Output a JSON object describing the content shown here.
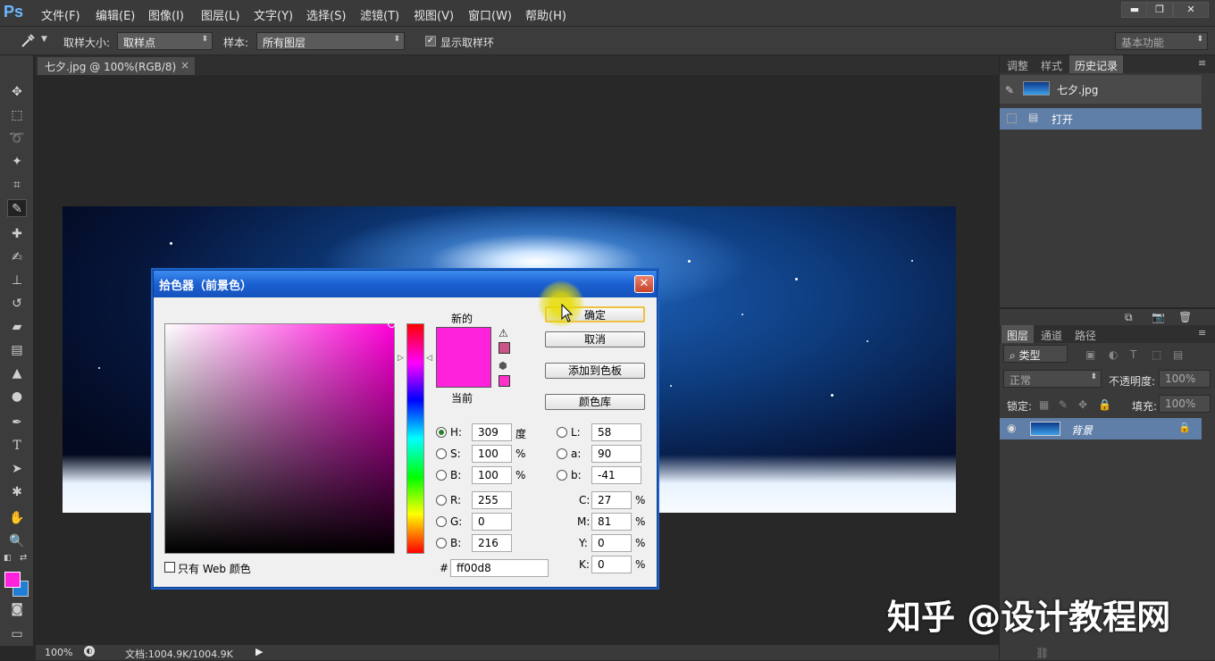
{
  "app": {
    "logo": "Ps"
  },
  "menu": [
    "文件(F)",
    "编辑(E)",
    "图像(I)",
    "图层(L)",
    "文字(Y)",
    "选择(S)",
    "滤镜(T)",
    "视图(V)",
    "窗口(W)",
    "帮助(H)"
  ],
  "window_controls": {
    "minimize": "▬",
    "restore": "❐",
    "close": "✕"
  },
  "options": {
    "sample_size_label": "取样大小:",
    "sample_size_value": "取样点",
    "sample_label": "样本:",
    "sample_value": "所有图层",
    "show_ring_label": "显示取样环",
    "show_ring_checked": true,
    "workspace": "基本功能"
  },
  "document": {
    "tab_title": "七夕.jpg @ 100%(RGB/8)",
    "close": "×"
  },
  "status": {
    "zoom": "100%",
    "doc_info": "文档:1004.9K/1004.9K"
  },
  "history_panel": {
    "tabs": [
      "调整",
      "样式",
      "历史记录"
    ],
    "snapshot": "七夕.jpg",
    "items": [
      "打开"
    ]
  },
  "layers_panel": {
    "tabs": [
      "图层",
      "通道",
      "路径"
    ],
    "filter": "类型",
    "blend_mode": "正常",
    "opacity_label": "不透明度:",
    "opacity": "100%",
    "lock_label": "锁定:",
    "fill_label": "填充:",
    "fill": "100%",
    "layers": [
      {
        "name": "背景",
        "visible": true,
        "locked": true
      }
    ]
  },
  "color_picker": {
    "title": "拾色器（前景色）",
    "close": "✕",
    "new_label": "新的",
    "current_label": "当前",
    "new_color": "#ff22dd",
    "current_color": "#ff22dd",
    "buttons": {
      "ok": "确定",
      "cancel": "取消",
      "add_swatch": "添加到色板",
      "color_libraries": "颜色库"
    },
    "hsb": [
      {
        "label": "H:",
        "value": "309",
        "unit": "度"
      },
      {
        "label": "S:",
        "value": "100",
        "unit": "%"
      },
      {
        "label": "B:",
        "value": "100",
        "unit": "%"
      }
    ],
    "rgb": [
      {
        "label": "R:",
        "value": "255"
      },
      {
        "label": "G:",
        "value": "0"
      },
      {
        "label": "B:",
        "value": "216"
      }
    ],
    "lab": [
      {
        "label": "L:",
        "value": "58"
      },
      {
        "label": "a:",
        "value": "90"
      },
      {
        "label": "b:",
        "value": "-41"
      }
    ],
    "cmyk": [
      {
        "label": "C:",
        "value": "27",
        "unit": "%"
      },
      {
        "label": "M:",
        "value": "81",
        "unit": "%"
      },
      {
        "label": "Y:",
        "value": "0",
        "unit": "%"
      },
      {
        "label": "K:",
        "value": "0",
        "unit": "%"
      }
    ],
    "selected_channel": "H",
    "hex_label": "#",
    "hex": "ff00d8",
    "web_only_label": "只有 Web 颜色",
    "web_only_checked": false
  },
  "foreground_color": "#ff22dd",
  "background_color": "#1f7fd6",
  "watermark": "知乎 @设计教程网"
}
